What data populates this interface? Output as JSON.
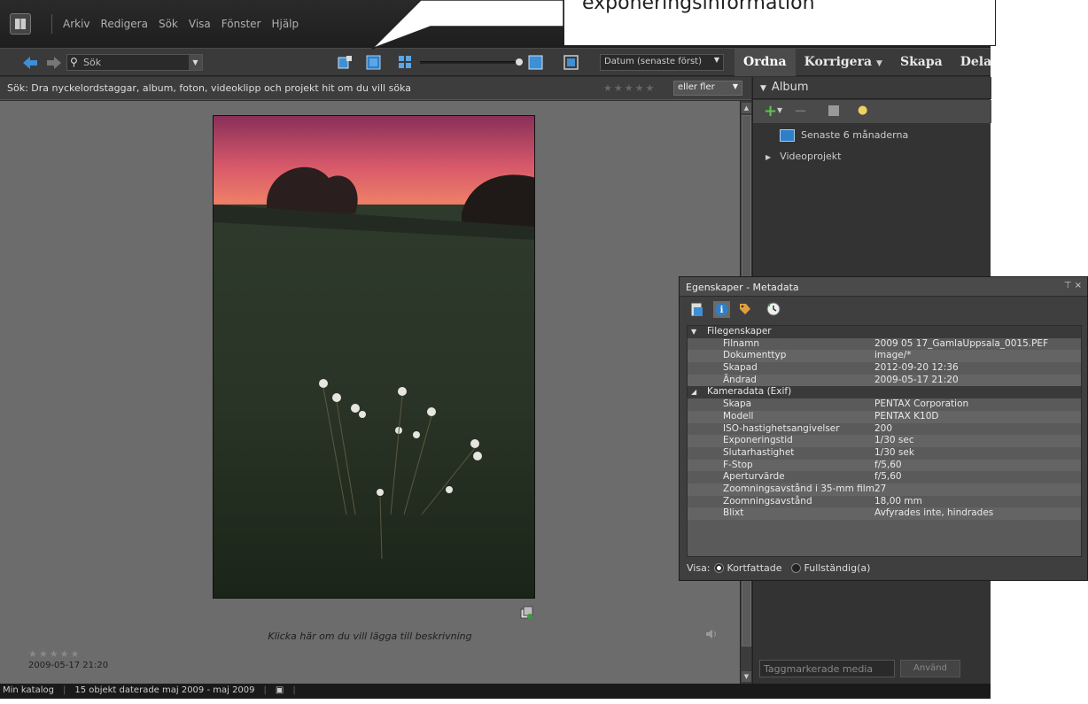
{
  "menu": {
    "items": [
      "Arkiv",
      "Redigera",
      "Sök",
      "Visa",
      "Fönster",
      "Hjälp"
    ]
  },
  "toolbar": {
    "search_placeholder": "Sök",
    "sort_label": "Datum (senaste först)",
    "tabs": [
      "Ordna",
      "Korrigera",
      "Skapa",
      "Dela"
    ]
  },
  "hint": {
    "text": "Sök: Dra nyckelordstaggar, album, foton, videoklipp och projekt hit om du vill söka",
    "rating_filter": "eller fler"
  },
  "photo": {
    "caption": "Klicka här om du vill lägga till beskrivning",
    "rating": "★★★★★",
    "date": "2009-05-17 21:20"
  },
  "status": {
    "catalog": "Min katalog",
    "info": "15 objekt daterade maj 2009 - maj 2009"
  },
  "album": {
    "title": "Album",
    "items": [
      "Senaste 6 månaderna",
      "Videoprojekt"
    ],
    "tag_placeholder": "Taggmarkerade media",
    "apply_label": "Använd"
  },
  "callout": {
    "text": "exponeringsinformation"
  },
  "metadata": {
    "title": "Egenskaper - Metadata",
    "sections": [
      {
        "name": "Filegenskaper",
        "rows": [
          {
            "k": "Filnamn",
            "v": "2009 05 17_GamlaUppsala_0015.PEF"
          },
          {
            "k": "Dokumenttyp",
            "v": "image/*"
          },
          {
            "k": "Skapad",
            "v": "2012-09-20 12:36"
          },
          {
            "k": "Ändrad",
            "v": "2009-05-17 21:20"
          }
        ]
      },
      {
        "name": "Kameradata (Exif)",
        "rows": [
          {
            "k": "Skapa",
            "v": "PENTAX Corporation"
          },
          {
            "k": "Modell",
            "v": "PENTAX K10D"
          },
          {
            "k": "ISO-hastighetsangivelser",
            "v": "200"
          },
          {
            "k": "Exponeringstid",
            "v": "1/30 sec"
          },
          {
            "k": "Slutarhastighet",
            "v": "1/30 sek"
          },
          {
            "k": "F-Stop",
            "v": "f/5,60"
          },
          {
            "k": "Aperturvärde",
            "v": "f/5,60"
          },
          {
            "k": "Zoomningsavstånd i 35-mm film",
            "v": "27"
          },
          {
            "k": "Zoomningsavstånd",
            "v": "18,00 mm"
          },
          {
            "k": "Blixt",
            "v": "Avfyrades inte, hindrades"
          }
        ]
      }
    ],
    "view_label": "Visa:",
    "view_options": [
      "Kortfattade",
      "Fullständig(a)"
    ]
  }
}
